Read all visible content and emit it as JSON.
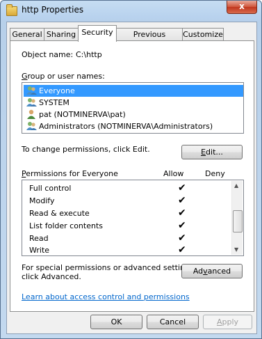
{
  "window": {
    "title": "http Properties",
    "close_glyph": "x"
  },
  "tabs": [
    {
      "label": "General"
    },
    {
      "label": "Sharing"
    },
    {
      "label": "Security"
    },
    {
      "label": "Previous Versions"
    },
    {
      "label": "Customize"
    }
  ],
  "active_tab": "Security",
  "object": {
    "label": "Object name:",
    "value": "C:\\http"
  },
  "group": {
    "label": "Group or user names:",
    "users": [
      {
        "name": "Everyone",
        "icon": "group-icon",
        "selected": true
      },
      {
        "name": "SYSTEM",
        "icon": "group-icon",
        "selected": false
      },
      {
        "name": "pat (NOTMINERVA\\pat)",
        "icon": "user-icon",
        "selected": false
      },
      {
        "name": "Administrators (NOTMINERVA\\Administrators)",
        "icon": "group-icon",
        "selected": false
      }
    ]
  },
  "change_text": "To change permissions, click Edit.",
  "edit_button": "Edit...",
  "permissions": {
    "label": "Permissions for Everyone",
    "allow_header": "Allow",
    "deny_header": "Deny",
    "rows": [
      {
        "name": "Full control",
        "allow": "✔"
      },
      {
        "name": "Modify",
        "allow": "✔"
      },
      {
        "name": "Read & execute",
        "allow": "✔"
      },
      {
        "name": "List folder contents",
        "allow": "✔"
      },
      {
        "name": "Read",
        "allow": "✔"
      },
      {
        "name": "Write",
        "allow": "✔"
      }
    ]
  },
  "special": {
    "line1": "For special permissions or advanced settings,",
    "line2": "click Advanced.",
    "advanced_button": "Advanced"
  },
  "learn_link": "Learn about access control and permissions",
  "footer": {
    "ok": "OK",
    "cancel": "Cancel",
    "apply": "Apply"
  },
  "colors": {
    "selection": "#3399ff",
    "link": "#0066cc"
  }
}
